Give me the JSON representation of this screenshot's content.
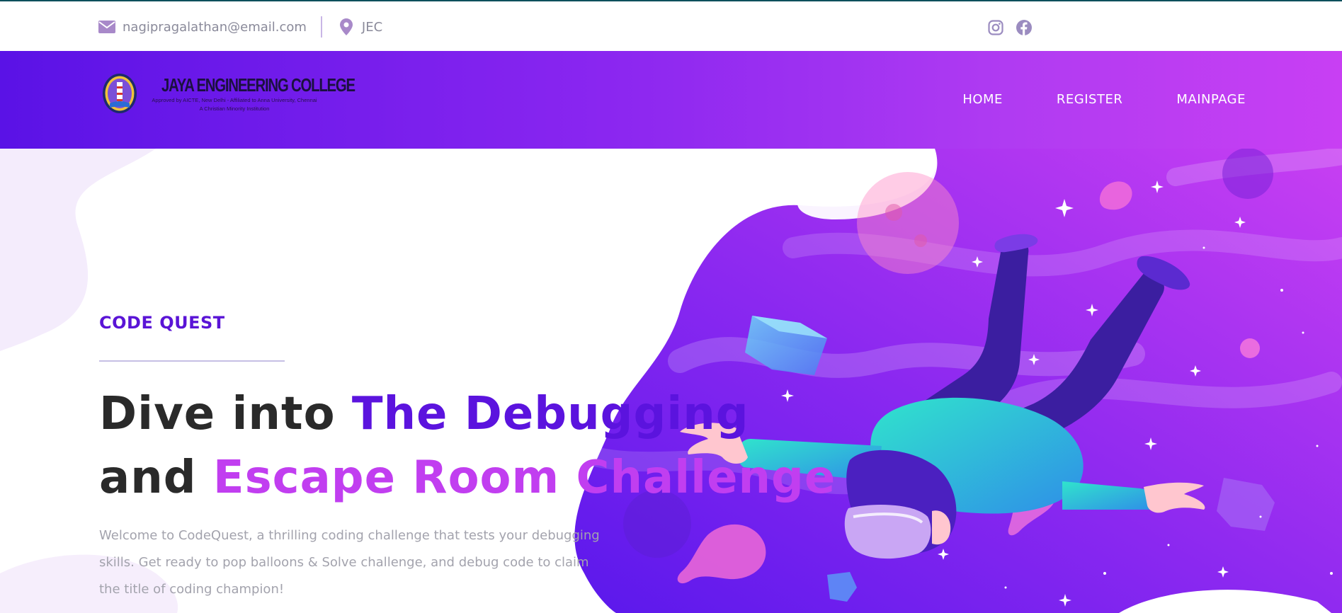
{
  "topbar": {
    "email": "nagipragalathan@email.com",
    "location": "JEC",
    "icons": [
      "envelope-icon",
      "map-pin-icon",
      "instagram-icon",
      "facebook-icon"
    ]
  },
  "header": {
    "logo": {
      "name": "JAYA ENGINEERING COLLEGE",
      "sub1": "Approved by AICTE, New Delhi - Affiliated to Anna University, Chennai",
      "sub2": "A Christian Minority Institution"
    },
    "nav": [
      {
        "label": "HOME"
      },
      {
        "label": "REGISTER"
      },
      {
        "label": "MAINPAGE"
      }
    ]
  },
  "hero": {
    "eyebrow": "CODE QUEST",
    "headline": {
      "part1": "Dive into ",
      "accent1": "The Debugging",
      "part2": "and ",
      "accent2": "Escape Room Challenge"
    },
    "lede": "Welcome to CodeQuest, a thrilling coding challenge that tests your debugging skills. Get ready to pop balloons & Solve challenge, and debug code to claim the title of coding champion!"
  },
  "colors": {
    "brand_start": "#5a12e6",
    "brand_end": "#c83ff3",
    "accent_dark": "#5b13de",
    "accent_light": "#c13ef0",
    "text_dark": "#2a2a2a",
    "text_muted": "#a3a3ad"
  }
}
